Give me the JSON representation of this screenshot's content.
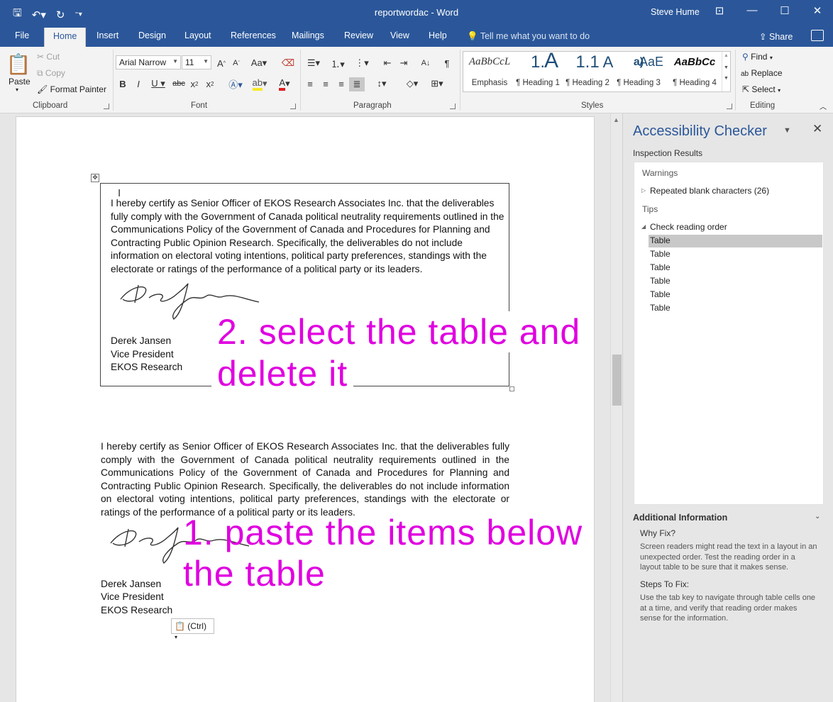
{
  "window": {
    "title": "reportwordac - Word",
    "user": "Steve Hume"
  },
  "tabs": [
    "File",
    "Home",
    "Insert",
    "Design",
    "Layout",
    "References",
    "Mailings",
    "Review",
    "View",
    "Help"
  ],
  "tell_me": "Tell me what you want to do",
  "share": "Share",
  "ribbon": {
    "clipboard": {
      "paste": "Paste",
      "cut": "Cut",
      "copy": "Copy",
      "format_painter": "Format Painter",
      "label": "Clipboard"
    },
    "font": {
      "name": "Arial Narrow",
      "size": "11",
      "label": "Font"
    },
    "paragraph": {
      "label": "Paragraph"
    },
    "styles": {
      "label": "Styles",
      "items": [
        {
          "preview": "AaBbCcL",
          "name": "Emphasis"
        },
        {
          "preview": "1.",
          "name": "¶ Heading 1"
        },
        {
          "preview": "A",
          "name": ""
        },
        {
          "preview": "1.1",
          "name": "¶ Heading 2"
        },
        {
          "preview": "A",
          "name": ""
        },
        {
          "preview": "a)",
          "name": "¶ Heading 3"
        },
        {
          "preview": "AaE",
          "name": ""
        },
        {
          "preview": "AaBbCc",
          "name": "¶ Heading 4"
        }
      ]
    },
    "editing": {
      "find": "Find",
      "replace": "Replace",
      "select": "Select",
      "label": "Editing"
    }
  },
  "document": {
    "certification": "I hereby certify as Senior Officer of EKOS Research Associates Inc. that the deliverables fully comply with the Government of Canada political neutrality requirements outlined in the Communications Policy of the Government of Canada and Procedures for Planning and Contracting Public Opinion Research. Specifically, the deliverables do not include information on electoral voting intentions, political party preferences, standings with the electorate or ratings of the performance of a political party or its leaders.",
    "signer_name": "Derek Jansen",
    "signer_title": "Vice President",
    "signer_org": "EKOS Research",
    "annotation_2": [
      "2. select the table and",
      "delete it"
    ],
    "annotation_1": [
      "1. paste the items below",
      "the table"
    ],
    "paste_options": "(Ctrl)"
  },
  "accessibility_pane": {
    "title": "Accessibility Checker",
    "subtitle": "Inspection Results",
    "warnings_label": "Warnings",
    "warning_item": "Repeated blank characters (26)",
    "tips_label": "Tips",
    "tip_item": "Check reading order",
    "tip_children": [
      "Table",
      "Table",
      "Table",
      "Table",
      "Table",
      "Table"
    ],
    "additional_info": "Additional Information",
    "why_fix_title": "Why Fix?",
    "why_fix_body": "Screen readers might read the text in a layout in an unexpected order. Test the reading order in a layout table to be sure that it makes sense.",
    "steps_title": "Steps To Fix:",
    "steps_body": "Use the tab key to navigate through table cells one at a time, and verify that reading  order makes sense for the information."
  }
}
